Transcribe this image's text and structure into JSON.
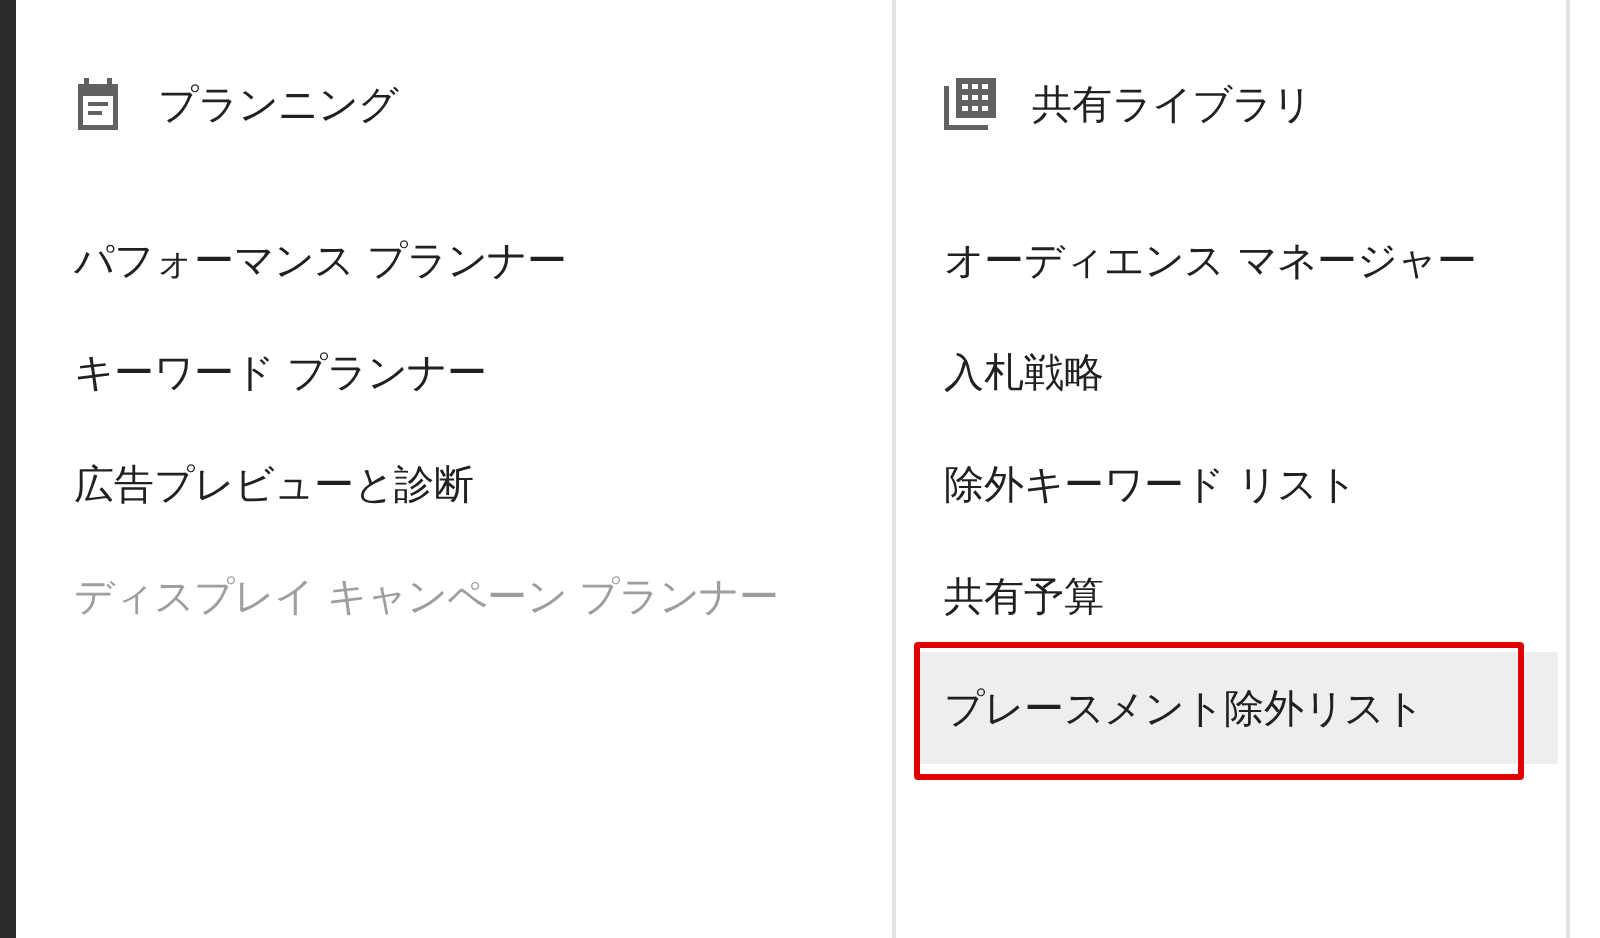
{
  "columns": [
    {
      "kind": "planning",
      "title": "プランニング",
      "items": [
        {
          "label": "パフォーマンス プランナー",
          "disabled": false,
          "selected": false,
          "annotated": false
        },
        {
          "label": "キーワード プランナー",
          "disabled": false,
          "selected": false,
          "annotated": false
        },
        {
          "label": "広告プレビューと診断",
          "disabled": false,
          "selected": false,
          "annotated": false
        },
        {
          "label": "ディスプレイ キャンペーン プランナー",
          "disabled": true,
          "selected": false,
          "annotated": false
        }
      ]
    },
    {
      "kind": "library",
      "title": "共有ライブラリ",
      "items": [
        {
          "label": "オーディエンス マネージャー",
          "disabled": false,
          "selected": false,
          "annotated": false
        },
        {
          "label": "入札戦略",
          "disabled": false,
          "selected": false,
          "annotated": false
        },
        {
          "label": "除外キーワード リスト",
          "disabled": false,
          "selected": false,
          "annotated": false
        },
        {
          "label": "共有予算",
          "disabled": false,
          "selected": false,
          "annotated": false
        },
        {
          "label": "プレースメント除外リスト",
          "disabled": false,
          "selected": true,
          "annotated": true
        }
      ]
    }
  ]
}
